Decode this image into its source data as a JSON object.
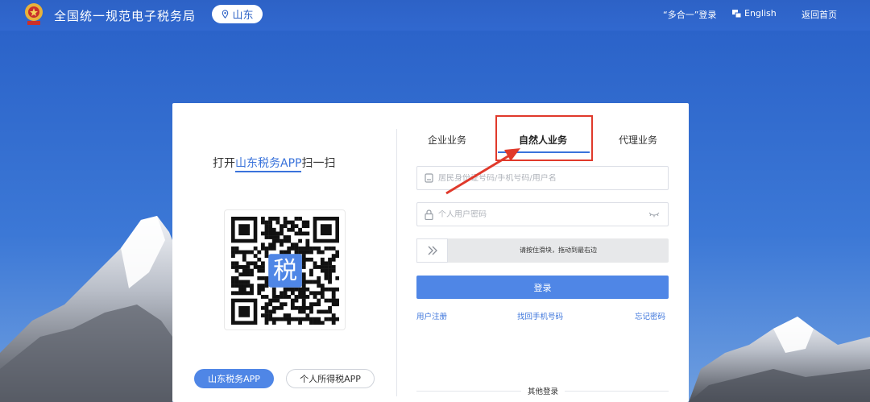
{
  "header": {
    "site_title": "全国统一规范电子税务局",
    "region": "山东",
    "links": {
      "multi_login": "“多合一”登录",
      "english": "English",
      "home": "返回首页"
    }
  },
  "qr_panel": {
    "scan_prefix": "打开",
    "app_name": "山东税务APP",
    "scan_suffix": "扫一扫",
    "qr_center_char": "税",
    "buttons": {
      "shandong_app": "山东税务APP",
      "personal_tax_app": "个人所得税APP"
    }
  },
  "tabs": [
    {
      "label": "企业业务",
      "active": false
    },
    {
      "label": "自然人业务",
      "active": true
    },
    {
      "label": "代理业务",
      "active": false
    }
  ],
  "form": {
    "id_placeholder": "居民身份证号码/手机号码/用户名",
    "password_placeholder": "个人用户密码",
    "slider_text": "请按住滑块，拖动到最右边",
    "login_button": "登录"
  },
  "links": {
    "register": "用户注册",
    "recover_phone": "找回手机号码",
    "forgot_password": "忘记密码"
  },
  "other_login": "其他登录",
  "colors": {
    "header_bg": "#2d62c6",
    "accent": "#3a73db",
    "button": "#4f86e6",
    "annotation": "#e0392b"
  }
}
